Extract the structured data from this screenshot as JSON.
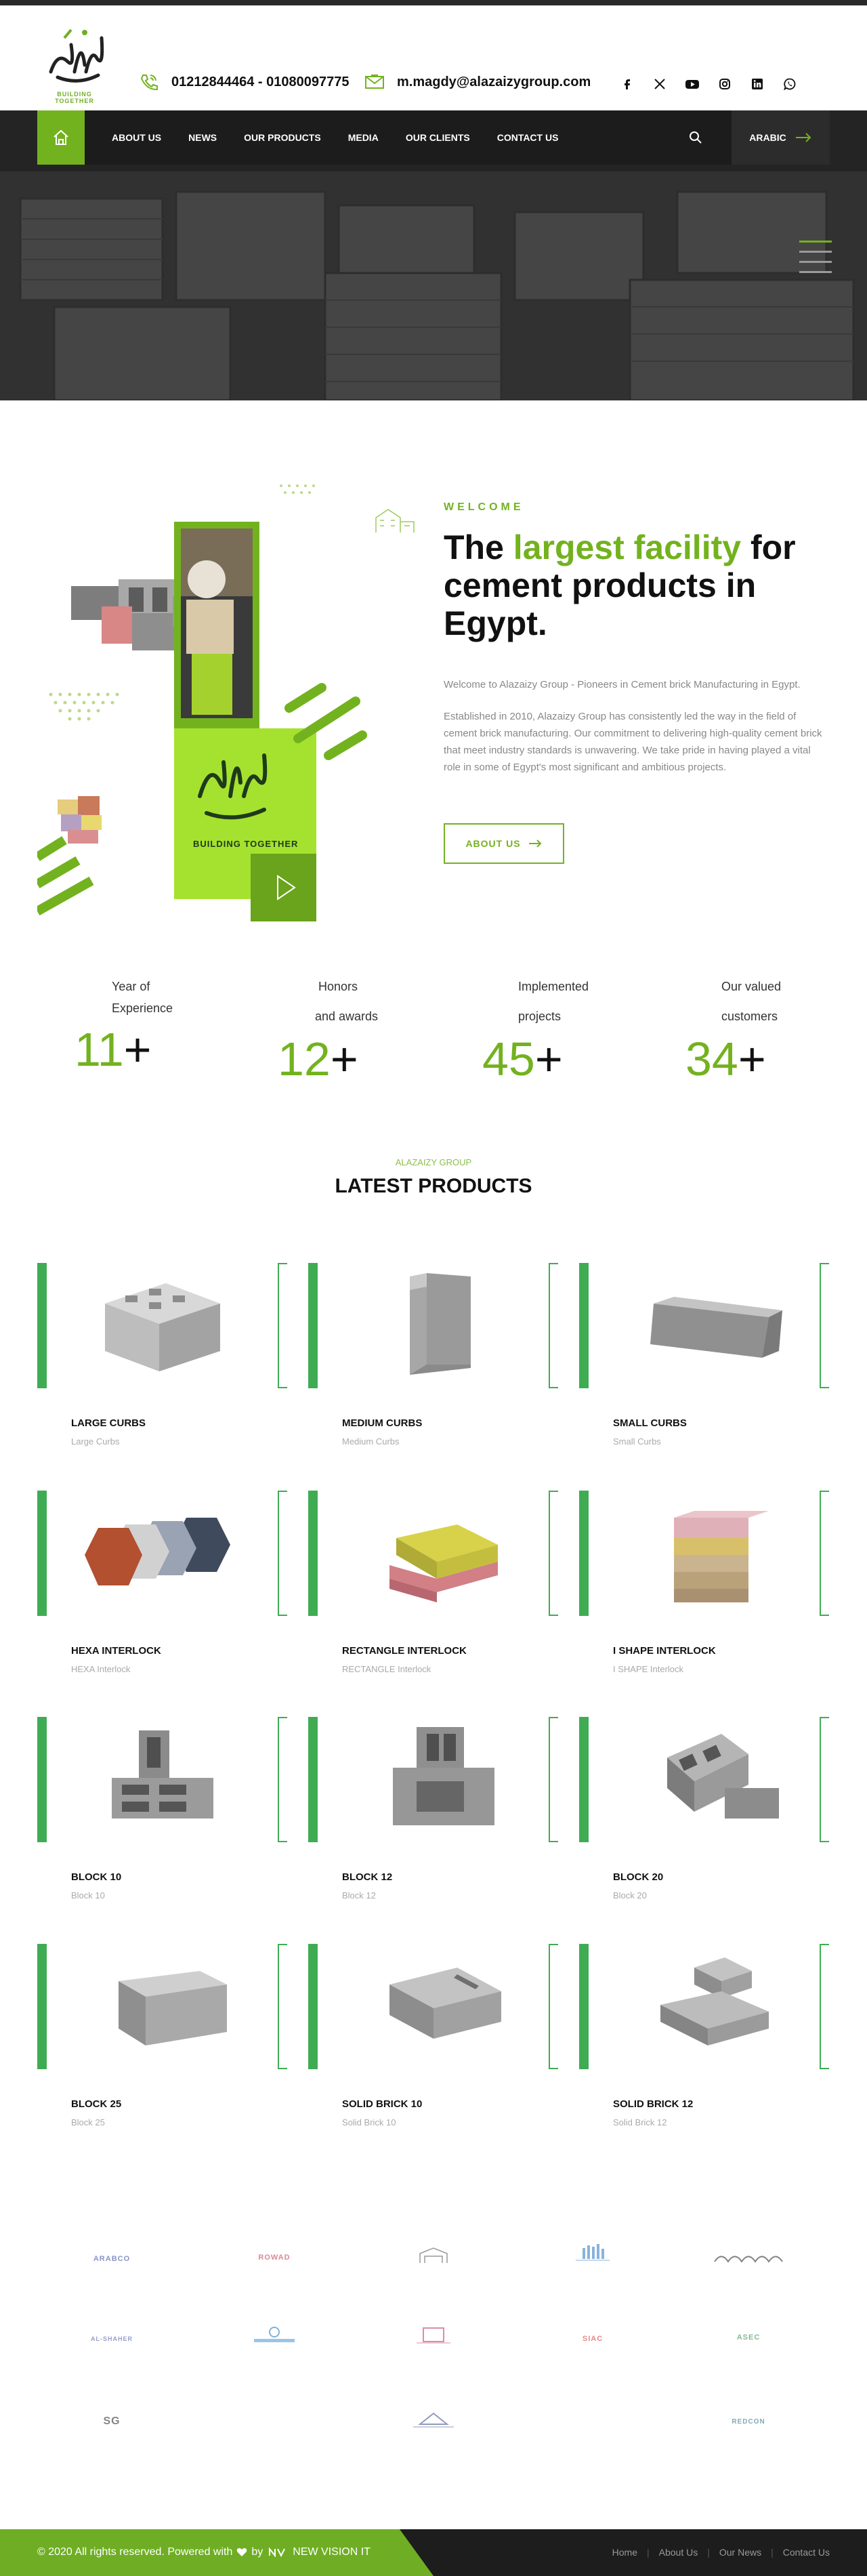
{
  "header": {
    "logo_tagline": "BUILDING TOGETHER",
    "phone": "01212844464 - 01080097775",
    "email": "m.magdy@alazaizygroup.com",
    "social": [
      "facebook-icon",
      "x-icon",
      "youtube-icon",
      "instagram-icon",
      "linkedin-icon",
      "whatsapp-icon"
    ]
  },
  "nav": {
    "items": [
      "ABOUT US",
      "NEWS",
      "OUR PRODUCTS",
      "MEDIA",
      "OUR CLIENTS",
      "CONTACT US"
    ],
    "lang": "ARABIC"
  },
  "welcome": {
    "label": "WELCOME",
    "title_pre": "The ",
    "title_hl": "largest facility",
    "title_post": " for cement products in Egypt.",
    "p1": "Welcome to Alazaizy Group - Pioneers in Cement brick Manufacturing in Egypt.",
    "p2": "Established in 2010, Alazaizy Group has consistently led the way in the field of cement brick manufacturing. Our commitment to delivering high-quality cement brick that meet industry standards is unwavering. We take pride in having played a vital role in some of Egypt's most significant and ambitious projects.",
    "button": "ABOUT US"
  },
  "stats": [
    {
      "line1": "Year of",
      "line2": "Experience",
      "value": "11"
    },
    {
      "line1": "Honors",
      "line2": "and awards",
      "value": "12"
    },
    {
      "line1": "Implemented",
      "line2": "projects",
      "value": "45"
    },
    {
      "line1": "Our valued",
      "line2": "customers",
      "value": "34"
    }
  ],
  "stat_plus": "+",
  "products": {
    "kicker": "ALAZAIZY GROUP",
    "heading": "LATEST PRODUCTS",
    "items": [
      {
        "name": "LARGE CURBS",
        "sub": "Large Curbs"
      },
      {
        "name": "MEDIUM CURBS",
        "sub": "Medium Curbs"
      },
      {
        "name": "SMALL CURBS",
        "sub": "Small Curbs"
      },
      {
        "name": "HEXA INTERLOCK",
        "sub": "HEXA Interlock"
      },
      {
        "name": "RECTANGLE INTERLOCK",
        "sub": "RECTANGLE Interlock"
      },
      {
        "name": "I SHAPE INTERLOCK",
        "sub": "I SHAPE Interlock"
      },
      {
        "name": "BLOCK 10",
        "sub": "Block 10"
      },
      {
        "name": "BLOCK 12",
        "sub": "Block 12"
      },
      {
        "name": "BLOCK 20",
        "sub": "Block 20"
      },
      {
        "name": "BLOCK 25",
        "sub": "Block 25"
      },
      {
        "name": "SOLID BRICK 10",
        "sub": "Solid Brick 10"
      },
      {
        "name": "SOLID BRICK 12",
        "sub": "Solid Brick 12"
      }
    ]
  },
  "clients": [
    "ARABCO",
    "ROWAD",
    "client-logo-3",
    "client-logo-4",
    "client-logo-5",
    "AL-SHAHER",
    "client-logo-7",
    "client-logo-8",
    "SIAC",
    "ASEC",
    "SG",
    "client-logo-12",
    "REDCON"
  ],
  "footer": {
    "copy_pre": "© 2020 All rights reserved. Powered with",
    "copy_by": "by",
    "company": "NEW VISION IT",
    "links": [
      "Home",
      "About Us",
      "Our News",
      "Contact Us"
    ]
  },
  "colors": {
    "accent": "#73b21f",
    "product_bar": "#3fac54",
    "dark": "#1c1c1c"
  }
}
